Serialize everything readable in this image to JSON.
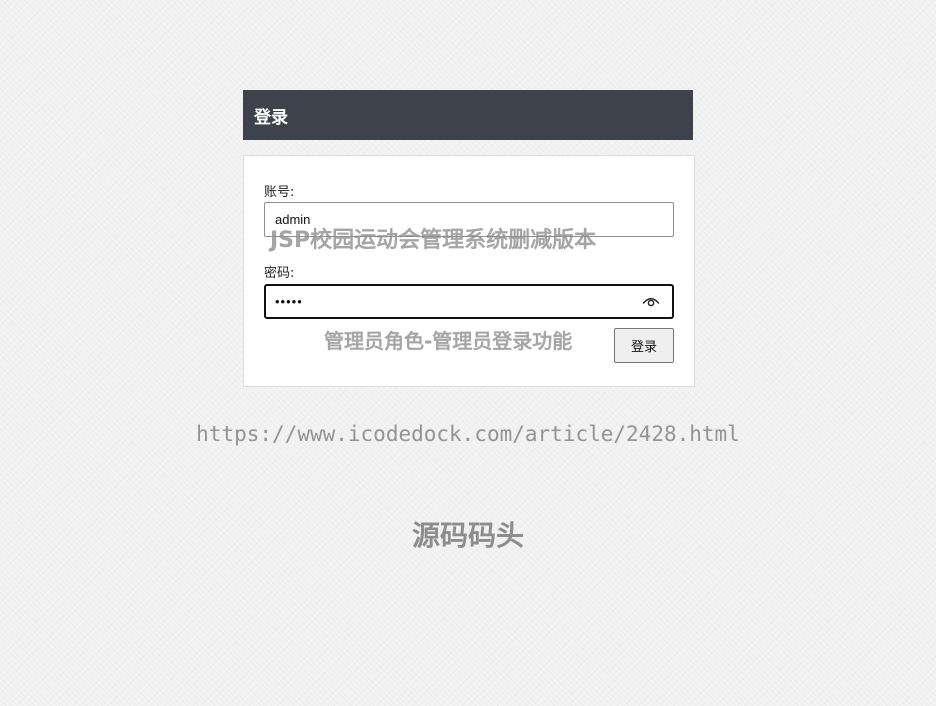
{
  "panel": {
    "title": "登录"
  },
  "form": {
    "account_label": "账号:",
    "account_value": "admin",
    "password_label": "密码:",
    "password_value": "admin",
    "password_icon": "eye-icon",
    "submit_label": "登录"
  },
  "watermarks": {
    "title": "JSP校园运动会管理系统删减版本",
    "subtitle": "管理员角色-管理员登录功能",
    "url": "https://www.icodedock.com/article/2428.html",
    "brand": "源码码头"
  }
}
